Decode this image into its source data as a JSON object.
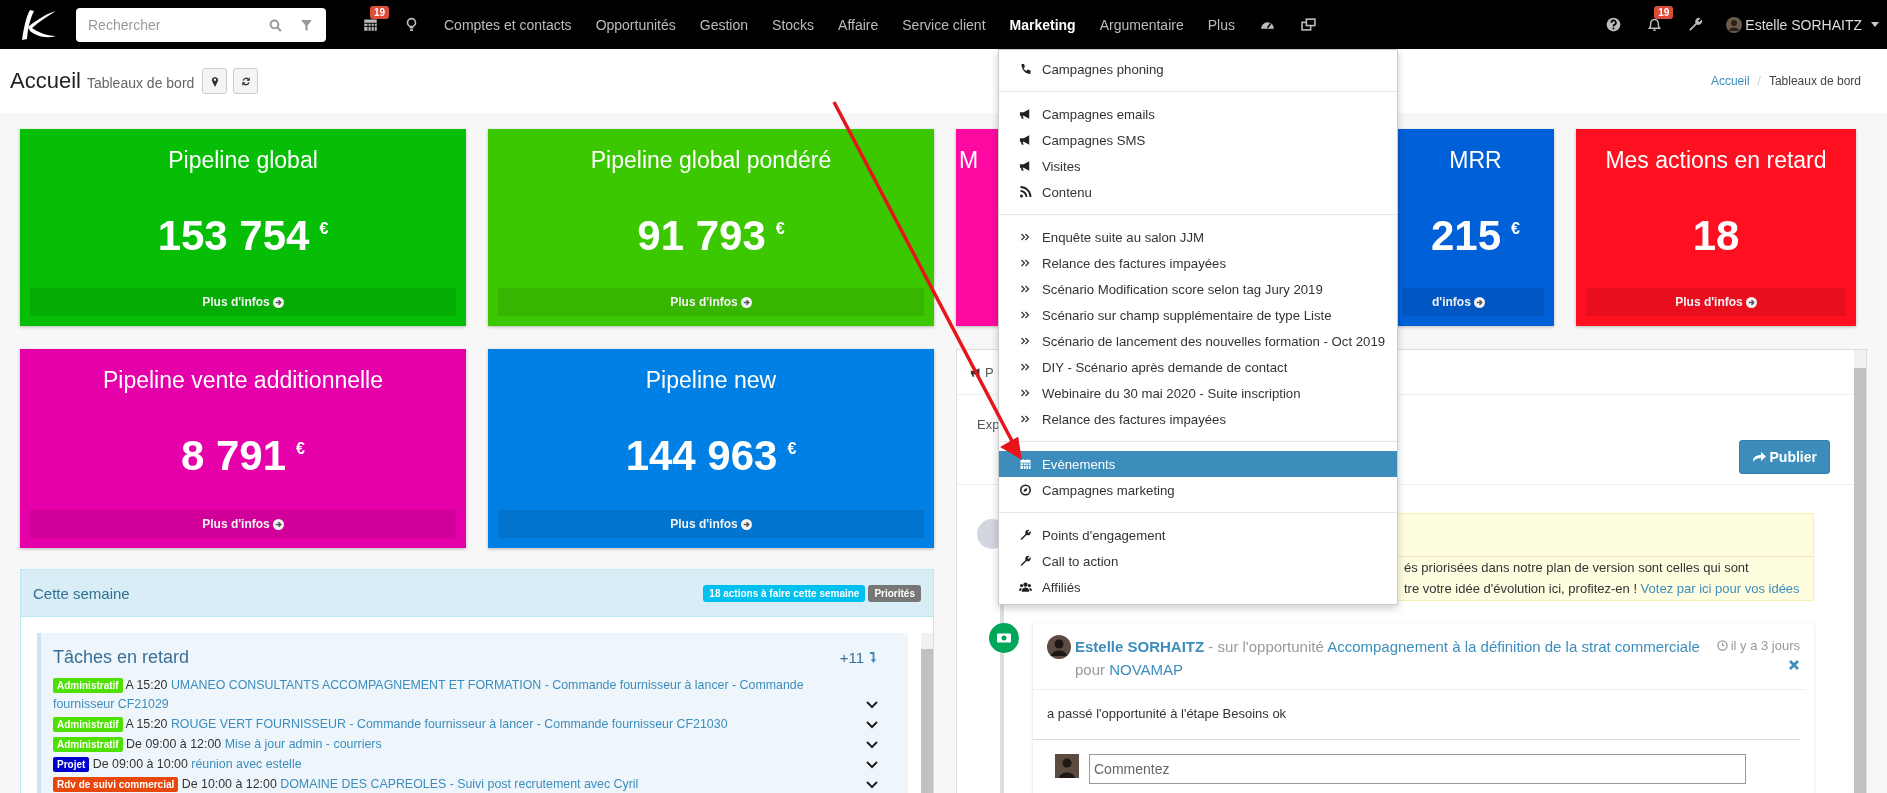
{
  "topbar": {
    "search": {
      "placeholder": "Rechercher"
    },
    "calendar_badge": "19",
    "nav": [
      {
        "label": "Comptes et contacts",
        "selected": false
      },
      {
        "label": "Opportunités",
        "selected": false
      },
      {
        "label": "Gestion",
        "selected": false
      },
      {
        "label": "Stocks",
        "selected": false
      },
      {
        "label": "Affaire",
        "selected": false
      },
      {
        "label": "Service client",
        "selected": false
      },
      {
        "label": "Marketing",
        "selected": true
      },
      {
        "label": "Argumentaire",
        "selected": false
      },
      {
        "label": "Plus",
        "selected": false
      }
    ],
    "notifications_badge": "19",
    "user": "Estelle SORHAITZ"
  },
  "header": {
    "title": "Accueil",
    "subtitle": "Tableaux de bord",
    "breadcrumb": [
      "Accueil",
      "Tableaux de bord"
    ],
    "separator": "/"
  },
  "cards": [
    {
      "title": "Pipeline global",
      "value": "153 754",
      "currency": "€",
      "footer": "Plus d'infos",
      "color": "#05be05"
    },
    {
      "title": "Pipeline global pondéré",
      "value": "91 793",
      "currency": "€",
      "footer": "Plus d'infos",
      "color": "#3cc800"
    },
    {
      "title": "M",
      "color": "#ff0aa0"
    },
    {
      "title": "MRR",
      "value": "215",
      "currency": "€",
      "footer": "d'infos",
      "color": "#0060d8"
    },
    {
      "title": "Mes actions en retard",
      "value": "18",
      "footer": "Plus d'infos",
      "color": "#ff1020"
    }
  ],
  "cards_row_2": [
    {
      "title": "Pipeline vente additionnelle",
      "value": "8 791",
      "currency": "€",
      "footer": "Plus d'infos",
      "color": "#e600aa"
    },
    {
      "title": "Pipeline new",
      "value": "144 963",
      "currency": "€",
      "footer": "Plus d'infos",
      "color": "#0080e4"
    }
  ],
  "week_panel": {
    "title": "Cette semaine",
    "badges": [
      {
        "label": "18 actions à faire cette semaine",
        "color": "#00c0ef"
      },
      {
        "label": "Priorités",
        "color": "#777777"
      }
    ],
    "section": {
      "title": "Tâches en retard",
      "more": "+11",
      "tasks": [
        {
          "tag": "Administratif",
          "color": "#4ee000",
          "time": "A 15:20",
          "link": "UMANEO CONSULTANTS ACCOMPAGNEMENT ET FORMATION - Commande fournisseur à lancer - Commande fournisseur CF21029"
        },
        {
          "tag": "Administratif",
          "color": "#4ee000",
          "time": "A 15:20",
          "link": "ROUGE VERT FOURNISSEUR - Commande fournisseur à lancer - Commande fournisseur CF21030"
        },
        {
          "tag": "Administratif",
          "color": "#4ee000",
          "time": "De 09:00 à 12:00",
          "link": "Mise à jour admin - courriers"
        },
        {
          "tag": "Projet",
          "color": "#0000cc",
          "time": "De 09:00 à 10:00",
          "link": "réunion avec estelle"
        },
        {
          "tag": "Rdv de suivi commercial",
          "color": "#e8470e",
          "time": "De 10:00 à 12:00",
          "link": "DOMAINE DES CAPREOLES - Suivi post recrutement avec Cyril"
        }
      ]
    }
  },
  "feed_panel": {
    "tab": "P",
    "text": "Exp",
    "publish": "Publier",
    "notice": {
      "line_1": "és priorisées dans notre plan de version sont celles qui sont",
      "line_2": "tre votre idée d'évolution ici, profitez-en !",
      "link": "Votez par ici pour vos idées"
    },
    "post": {
      "author": "Estelle SORHAITZ",
      "relation": "- sur l'opportunité",
      "opportunity": "Accompagnement à la définition de la strat commerciale",
      "for": "pour",
      "company": "NOVAMAP",
      "time": "il y a 3 jours",
      "body": "a passé l'opportunité à l'étape Besoins ok",
      "comment": {
        "placeholder": "Commentez"
      }
    }
  },
  "marketing_menu": {
    "groups": [
      [
        {
          "label": "Campagnes phoning",
          "kind": "phone",
          "selected": false
        }
      ],
      [
        {
          "label": "Campagnes emails",
          "kind": "megaphone",
          "selected": false
        },
        {
          "label": "Campagnes SMS",
          "kind": "megaphone",
          "selected": false
        },
        {
          "label": "Visites",
          "kind": "megaphone",
          "selected": false
        },
        {
          "label": "Contenu",
          "kind": "rss",
          "selected": false
        }
      ],
      [
        {
          "label": "Enquête suite au salon JJM",
          "kind": "chevrons",
          "selected": false
        },
        {
          "label": "Relance des factures impayées",
          "kind": "chevrons",
          "selected": false
        },
        {
          "label": "Scénario Modification score selon tag Jury 2019",
          "kind": "chevrons",
          "selected": false
        },
        {
          "label": "Scénario sur champ supplémentaire de type Liste",
          "kind": "chevrons",
          "selected": false
        },
        {
          "label": "Scénario de lancement des nouvelles formation - Oct 2019",
          "kind": "chevrons",
          "selected": false
        },
        {
          "label": "DIY - Scénario après demande de contact",
          "kind": "chevrons",
          "selected": false
        },
        {
          "label": "Webinaire du 30 mai 2020 - Suite inscription",
          "kind": "chevrons",
          "selected": false
        },
        {
          "label": "Relance des factures impayées",
          "kind": "chevrons",
          "selected": false
        }
      ],
      [
        {
          "label": "Evènements",
          "kind": "calendar",
          "selected": true
        },
        {
          "label": "Campagnes marketing",
          "kind": "compass",
          "selected": false
        }
      ],
      [
        {
          "label": "Points d'engagement",
          "kind": "wrench",
          "selected": false
        },
        {
          "label": "Call to action",
          "kind": "wrench",
          "selected": false
        },
        {
          "label": "Affiliés",
          "kind": "users",
          "selected": false
        }
      ]
    ]
  }
}
